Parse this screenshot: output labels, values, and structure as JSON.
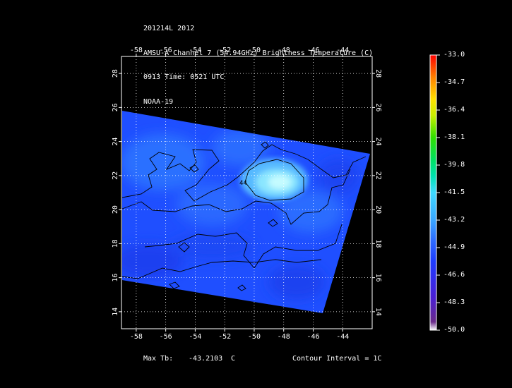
{
  "title": {
    "line1": "201214L 2012",
    "line2": "AMSU-A Channel 7 (54.94GHz) Brightness Temperature (C)",
    "line3": "0913 Time: 0521 UTC",
    "line4": "NOAA-19"
  },
  "map": {
    "lon_range": [
      -59,
      -42
    ],
    "lat_range": [
      13,
      29
    ],
    "lon_ticks": [
      "-58",
      "-56",
      "-54",
      "-52",
      "-50",
      "-48",
      "-46",
      "-44"
    ],
    "lat_ticks": [
      "14",
      "16",
      "18",
      "20",
      "22",
      "24",
      "26",
      "28"
    ],
    "contour_label": "44",
    "colors": {
      "field": "#1f5cff",
      "warm_core": "#9ff3ff",
      "background": "#000000"
    }
  },
  "colorbar": {
    "labels": [
      "-33.0",
      "-34.7",
      "-36.4",
      "-38.1",
      "-39.8",
      "-41.5",
      "-43.2",
      "-44.9",
      "-46.6",
      "-48.3",
      "-50.0"
    ]
  },
  "footer": {
    "max_label": "Max Tb:",
    "max_value": "-43.2103",
    "max_unit": "C",
    "contour_interval": "Contour Interval = 1C"
  }
}
